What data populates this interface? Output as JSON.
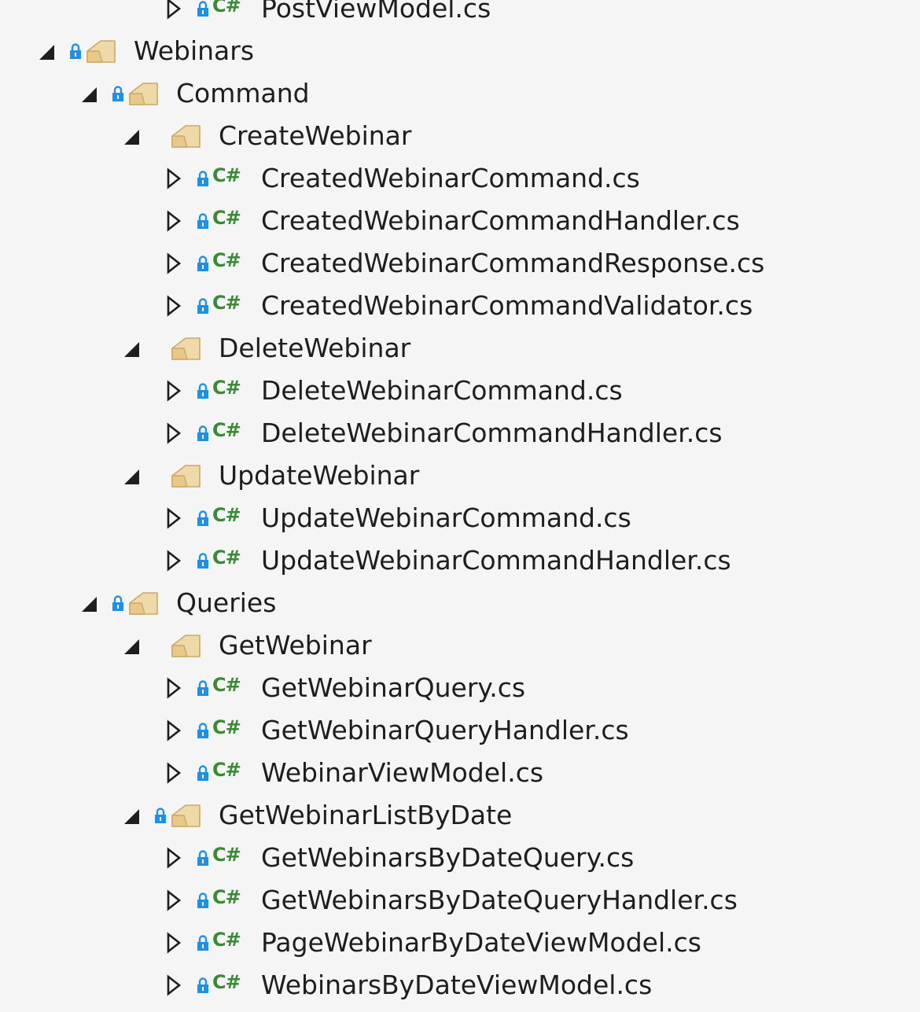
{
  "colors": {
    "background": "#f5f5f5",
    "text": "#1e1e1e",
    "lock": "#1e90e8",
    "csharp": "#388a34",
    "folder_fill": "#f0d9a8",
    "folder_stroke": "#c9a96a"
  },
  "csharp_glyph": "C#",
  "tree": [
    {
      "label": "PostViewModel.cs",
      "kind": "file",
      "expanded": false,
      "locked": true,
      "depth": 4,
      "icon": "csharp-file-icon"
    },
    {
      "label": "Webinars",
      "kind": "folder",
      "expanded": true,
      "locked": true,
      "depth": 1,
      "icon": "folder-icon"
    },
    {
      "label": "Command",
      "kind": "folder",
      "expanded": true,
      "locked": true,
      "depth": 2,
      "icon": "folder-icon"
    },
    {
      "label": "CreateWebinar",
      "kind": "folder",
      "expanded": true,
      "locked": false,
      "depth": 3,
      "icon": "folder-icon"
    },
    {
      "label": "CreatedWebinarCommand.cs",
      "kind": "file",
      "expanded": false,
      "locked": true,
      "depth": 4,
      "icon": "csharp-file-icon"
    },
    {
      "label": "CreatedWebinarCommandHandler.cs",
      "kind": "file",
      "expanded": false,
      "locked": true,
      "depth": 4,
      "icon": "csharp-file-icon"
    },
    {
      "label": "CreatedWebinarCommandResponse.cs",
      "kind": "file",
      "expanded": false,
      "locked": true,
      "depth": 4,
      "icon": "csharp-file-icon"
    },
    {
      "label": "CreatedWebinarCommandValidator.cs",
      "kind": "file",
      "expanded": false,
      "locked": true,
      "depth": 4,
      "icon": "csharp-file-icon"
    },
    {
      "label": "DeleteWebinar",
      "kind": "folder",
      "expanded": true,
      "locked": false,
      "depth": 3,
      "icon": "folder-icon"
    },
    {
      "label": "DeleteWebinarCommand.cs",
      "kind": "file",
      "expanded": false,
      "locked": true,
      "depth": 4,
      "icon": "csharp-file-icon"
    },
    {
      "label": "DeleteWebinarCommandHandler.cs",
      "kind": "file",
      "expanded": false,
      "locked": true,
      "depth": 4,
      "icon": "csharp-file-icon"
    },
    {
      "label": "UpdateWebinar",
      "kind": "folder",
      "expanded": true,
      "locked": false,
      "depth": 3,
      "icon": "folder-icon"
    },
    {
      "label": "UpdateWebinarCommand.cs",
      "kind": "file",
      "expanded": false,
      "locked": true,
      "depth": 4,
      "icon": "csharp-file-icon"
    },
    {
      "label": "UpdateWebinarCommandHandler.cs",
      "kind": "file",
      "expanded": false,
      "locked": true,
      "depth": 4,
      "icon": "csharp-file-icon"
    },
    {
      "label": "Queries",
      "kind": "folder",
      "expanded": true,
      "locked": true,
      "depth": 2,
      "icon": "folder-icon"
    },
    {
      "label": "GetWebinar",
      "kind": "folder",
      "expanded": true,
      "locked": false,
      "depth": 3,
      "icon": "folder-icon"
    },
    {
      "label": "GetWebinarQuery.cs",
      "kind": "file",
      "expanded": false,
      "locked": true,
      "depth": 4,
      "icon": "csharp-file-icon"
    },
    {
      "label": "GetWebinarQueryHandler.cs",
      "kind": "file",
      "expanded": false,
      "locked": true,
      "depth": 4,
      "icon": "csharp-file-icon"
    },
    {
      "label": "WebinarViewModel.cs",
      "kind": "file",
      "expanded": false,
      "locked": true,
      "depth": 4,
      "icon": "csharp-file-icon"
    },
    {
      "label": "GetWebinarListByDate",
      "kind": "folder",
      "expanded": true,
      "locked": true,
      "depth": 3,
      "icon": "folder-icon"
    },
    {
      "label": "GetWebinarsByDateQuery.cs",
      "kind": "file",
      "expanded": false,
      "locked": true,
      "depth": 4,
      "icon": "csharp-file-icon"
    },
    {
      "label": "GetWebinarsByDateQueryHandler.cs",
      "kind": "file",
      "expanded": false,
      "locked": true,
      "depth": 4,
      "icon": "csharp-file-icon"
    },
    {
      "label": "PageWebinarByDateViewModel.cs",
      "kind": "file",
      "expanded": false,
      "locked": true,
      "depth": 4,
      "icon": "csharp-file-icon"
    },
    {
      "label": "WebinarsByDateViewModel.cs",
      "kind": "file",
      "expanded": false,
      "locked": true,
      "depth": 4,
      "icon": "csharp-file-icon"
    }
  ]
}
